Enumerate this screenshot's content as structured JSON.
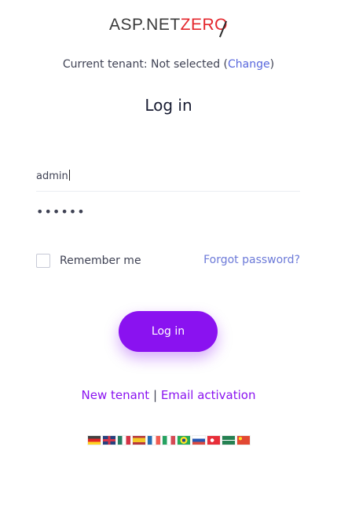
{
  "logo": {
    "part1": "ASP.NET",
    "part2": "ZERO"
  },
  "tenant": {
    "prefix": "Current tenant: Not selected (",
    "change_link": "Change",
    "suffix": ")"
  },
  "page_title": "Log in",
  "form": {
    "username_value": "admin",
    "password_value": "••••••",
    "remember_label": "Remember me",
    "remember_checked": false,
    "forgot_label": "Forgot password?",
    "submit_label": "Log in"
  },
  "links": {
    "new_tenant": "New tenant",
    "separator": "|",
    "email_activation": "Email activation"
  },
  "languages": [
    "flag-de-icon",
    "flag-gb-icon",
    "flag-mx-icon",
    "flag-es-icon",
    "flag-fr-icon",
    "flag-it-icon",
    "flag-br-icon",
    "flag-ru-icon",
    "flag-tr-icon",
    "flag-sa-icon",
    "flag-cn-icon"
  ],
  "colors": {
    "accent": "#8a12f0",
    "link_blue": "#5867dd",
    "logo_red": "#e4252b"
  }
}
